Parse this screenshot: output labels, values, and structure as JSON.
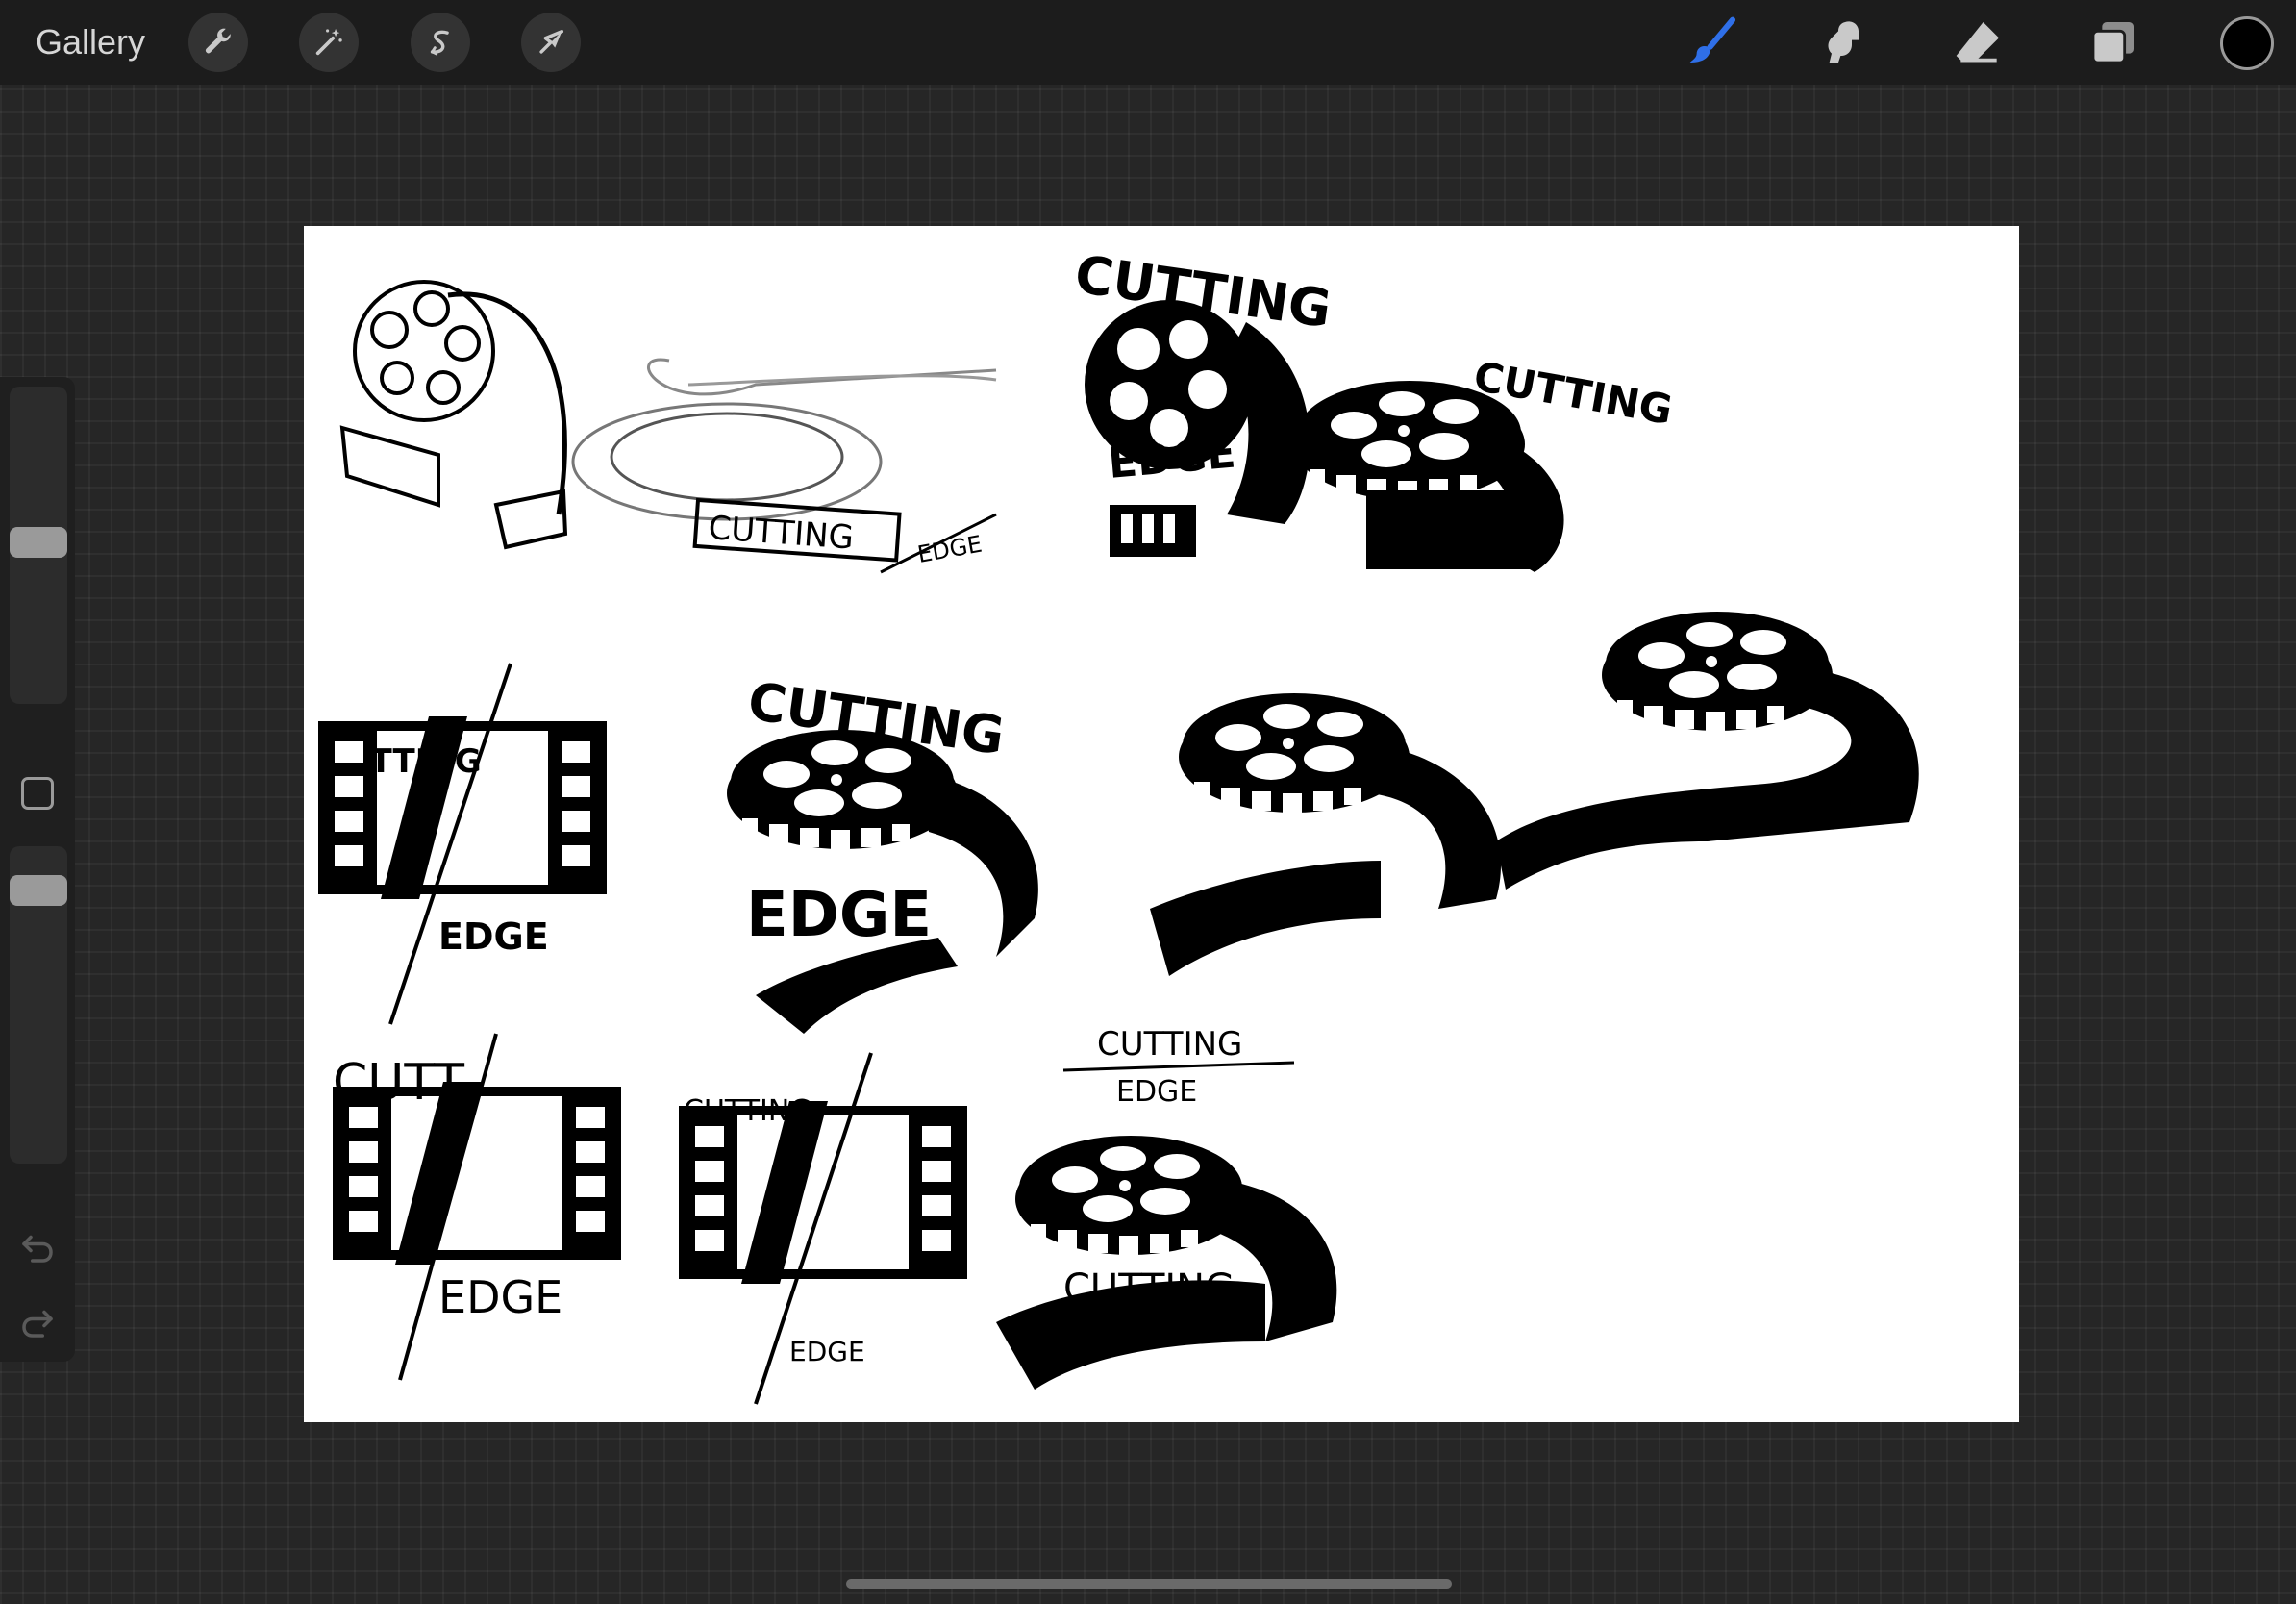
{
  "toolbar": {
    "gallery_label": "Gallery",
    "left_tools": [
      {
        "name": "actions",
        "icon": "wrench-icon"
      },
      {
        "name": "adjustments",
        "icon": "magic-wand-icon"
      },
      {
        "name": "selection",
        "icon": "selection-s-icon"
      },
      {
        "name": "transform",
        "icon": "arrow-cursor-icon"
      }
    ],
    "right_tools": [
      {
        "name": "brush",
        "icon": "brush-icon",
        "active": true,
        "color": "#2f6fe8"
      },
      {
        "name": "smudge",
        "icon": "smudge-icon",
        "active": false
      },
      {
        "name": "eraser",
        "icon": "eraser-icon",
        "active": false
      },
      {
        "name": "layers",
        "icon": "layers-icon",
        "active": false
      }
    ],
    "current_color": "#000000"
  },
  "sidebar": {
    "brush_size_level": 0.48,
    "opacity_level": 0.92,
    "modify_icon": "square-icon",
    "undo_icon": "undo-icon",
    "redo_icon": "redo-icon"
  },
  "canvas": {
    "background": "#ffffff",
    "sketch_text": {
      "cutting": "CUTTING",
      "edge": "EDGE",
      "cutting_small": "CUTTING",
      "edge_small": "EDGE",
      "cutt_partial": "CUTT.",
      "edge_cross": "EDGE",
      "edge_scribble": "EDGE"
    }
  },
  "accent_colors": {
    "toolbar_bg": "#1c1c1c",
    "workspace_bg": "#262626",
    "active_tool": "#2f6fe8"
  }
}
